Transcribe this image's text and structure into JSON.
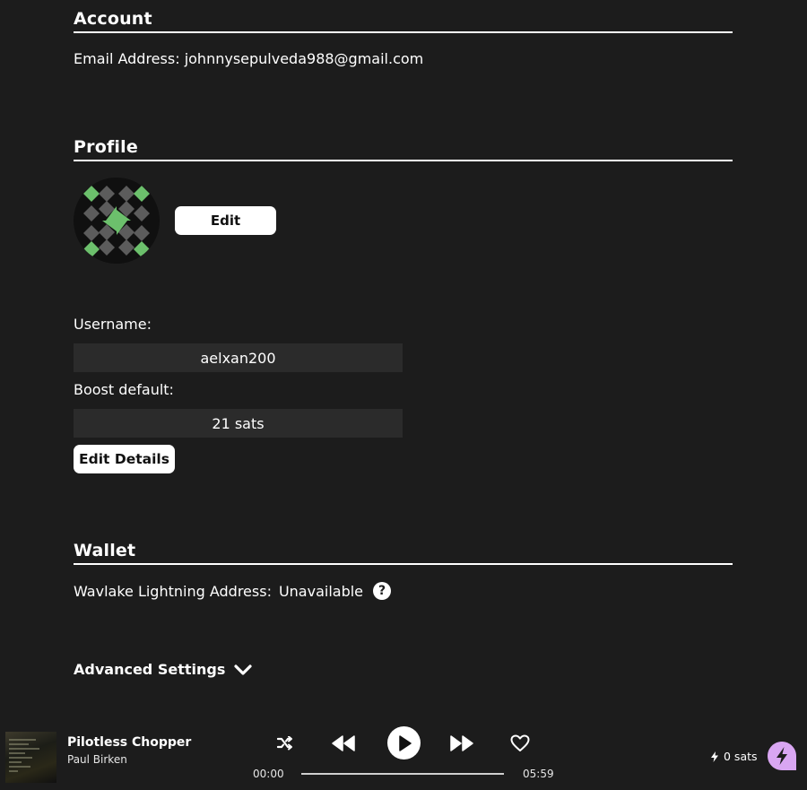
{
  "account": {
    "title": "Account",
    "email_label": "Email Address:",
    "email_value": "johnnysepulveda988@gmail.com"
  },
  "profile": {
    "title": "Profile",
    "edit_button": "Edit",
    "username_label": "Username:",
    "username_value": "aelxan200",
    "boost_label": "Boost default:",
    "boost_value": "21 sats",
    "edit_details_button": "Edit Details"
  },
  "wallet": {
    "title": "Wallet",
    "lightning_label": "Wavlake Lightning Address:",
    "lightning_value": "Unavailable",
    "help_icon": "?"
  },
  "advanced": {
    "label": "Advanced Settings"
  },
  "player": {
    "track_title": "Pilotless Chopper",
    "artist": "Paul Birken",
    "elapsed": "00:00",
    "duration": "05:59",
    "progress": 0,
    "sats": "0 sats"
  },
  "colors": {
    "background": "#1c1c1c",
    "field_background": "#2b2b2b",
    "avatar_green": "#6cc06c",
    "avatar_gray": "#5c5c5c",
    "boost_pink": "#d9a6f2"
  }
}
